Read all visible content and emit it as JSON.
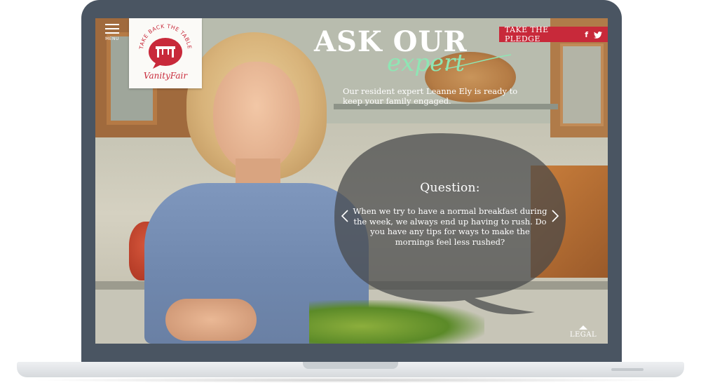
{
  "menu": {
    "label": "MENU"
  },
  "logo": {
    "tagline": "TAKE BACK THE TABLE",
    "brand": "VanityFair"
  },
  "header": {
    "title": "ASK OUR",
    "title_script": "expert",
    "subtitle": "Our resident expert Leanne Ely is ready to keep your family engaged."
  },
  "pledge": {
    "label": "TAKE THE PLEDGE",
    "facebook": "f",
    "twitter": "t"
  },
  "question": {
    "heading": "Question:",
    "text": "When we try to have a normal breakfast during the week, we always end up having to rush. Do you have any tips for ways to make the mornings feel less rushed?"
  },
  "footer": {
    "legal": "LEGAL"
  },
  "colors": {
    "accent_red": "#c8293a",
    "script_green": "#8ee6b4",
    "frame": "#4a5562",
    "bubble": "rgba(70,72,74,0.72)"
  }
}
